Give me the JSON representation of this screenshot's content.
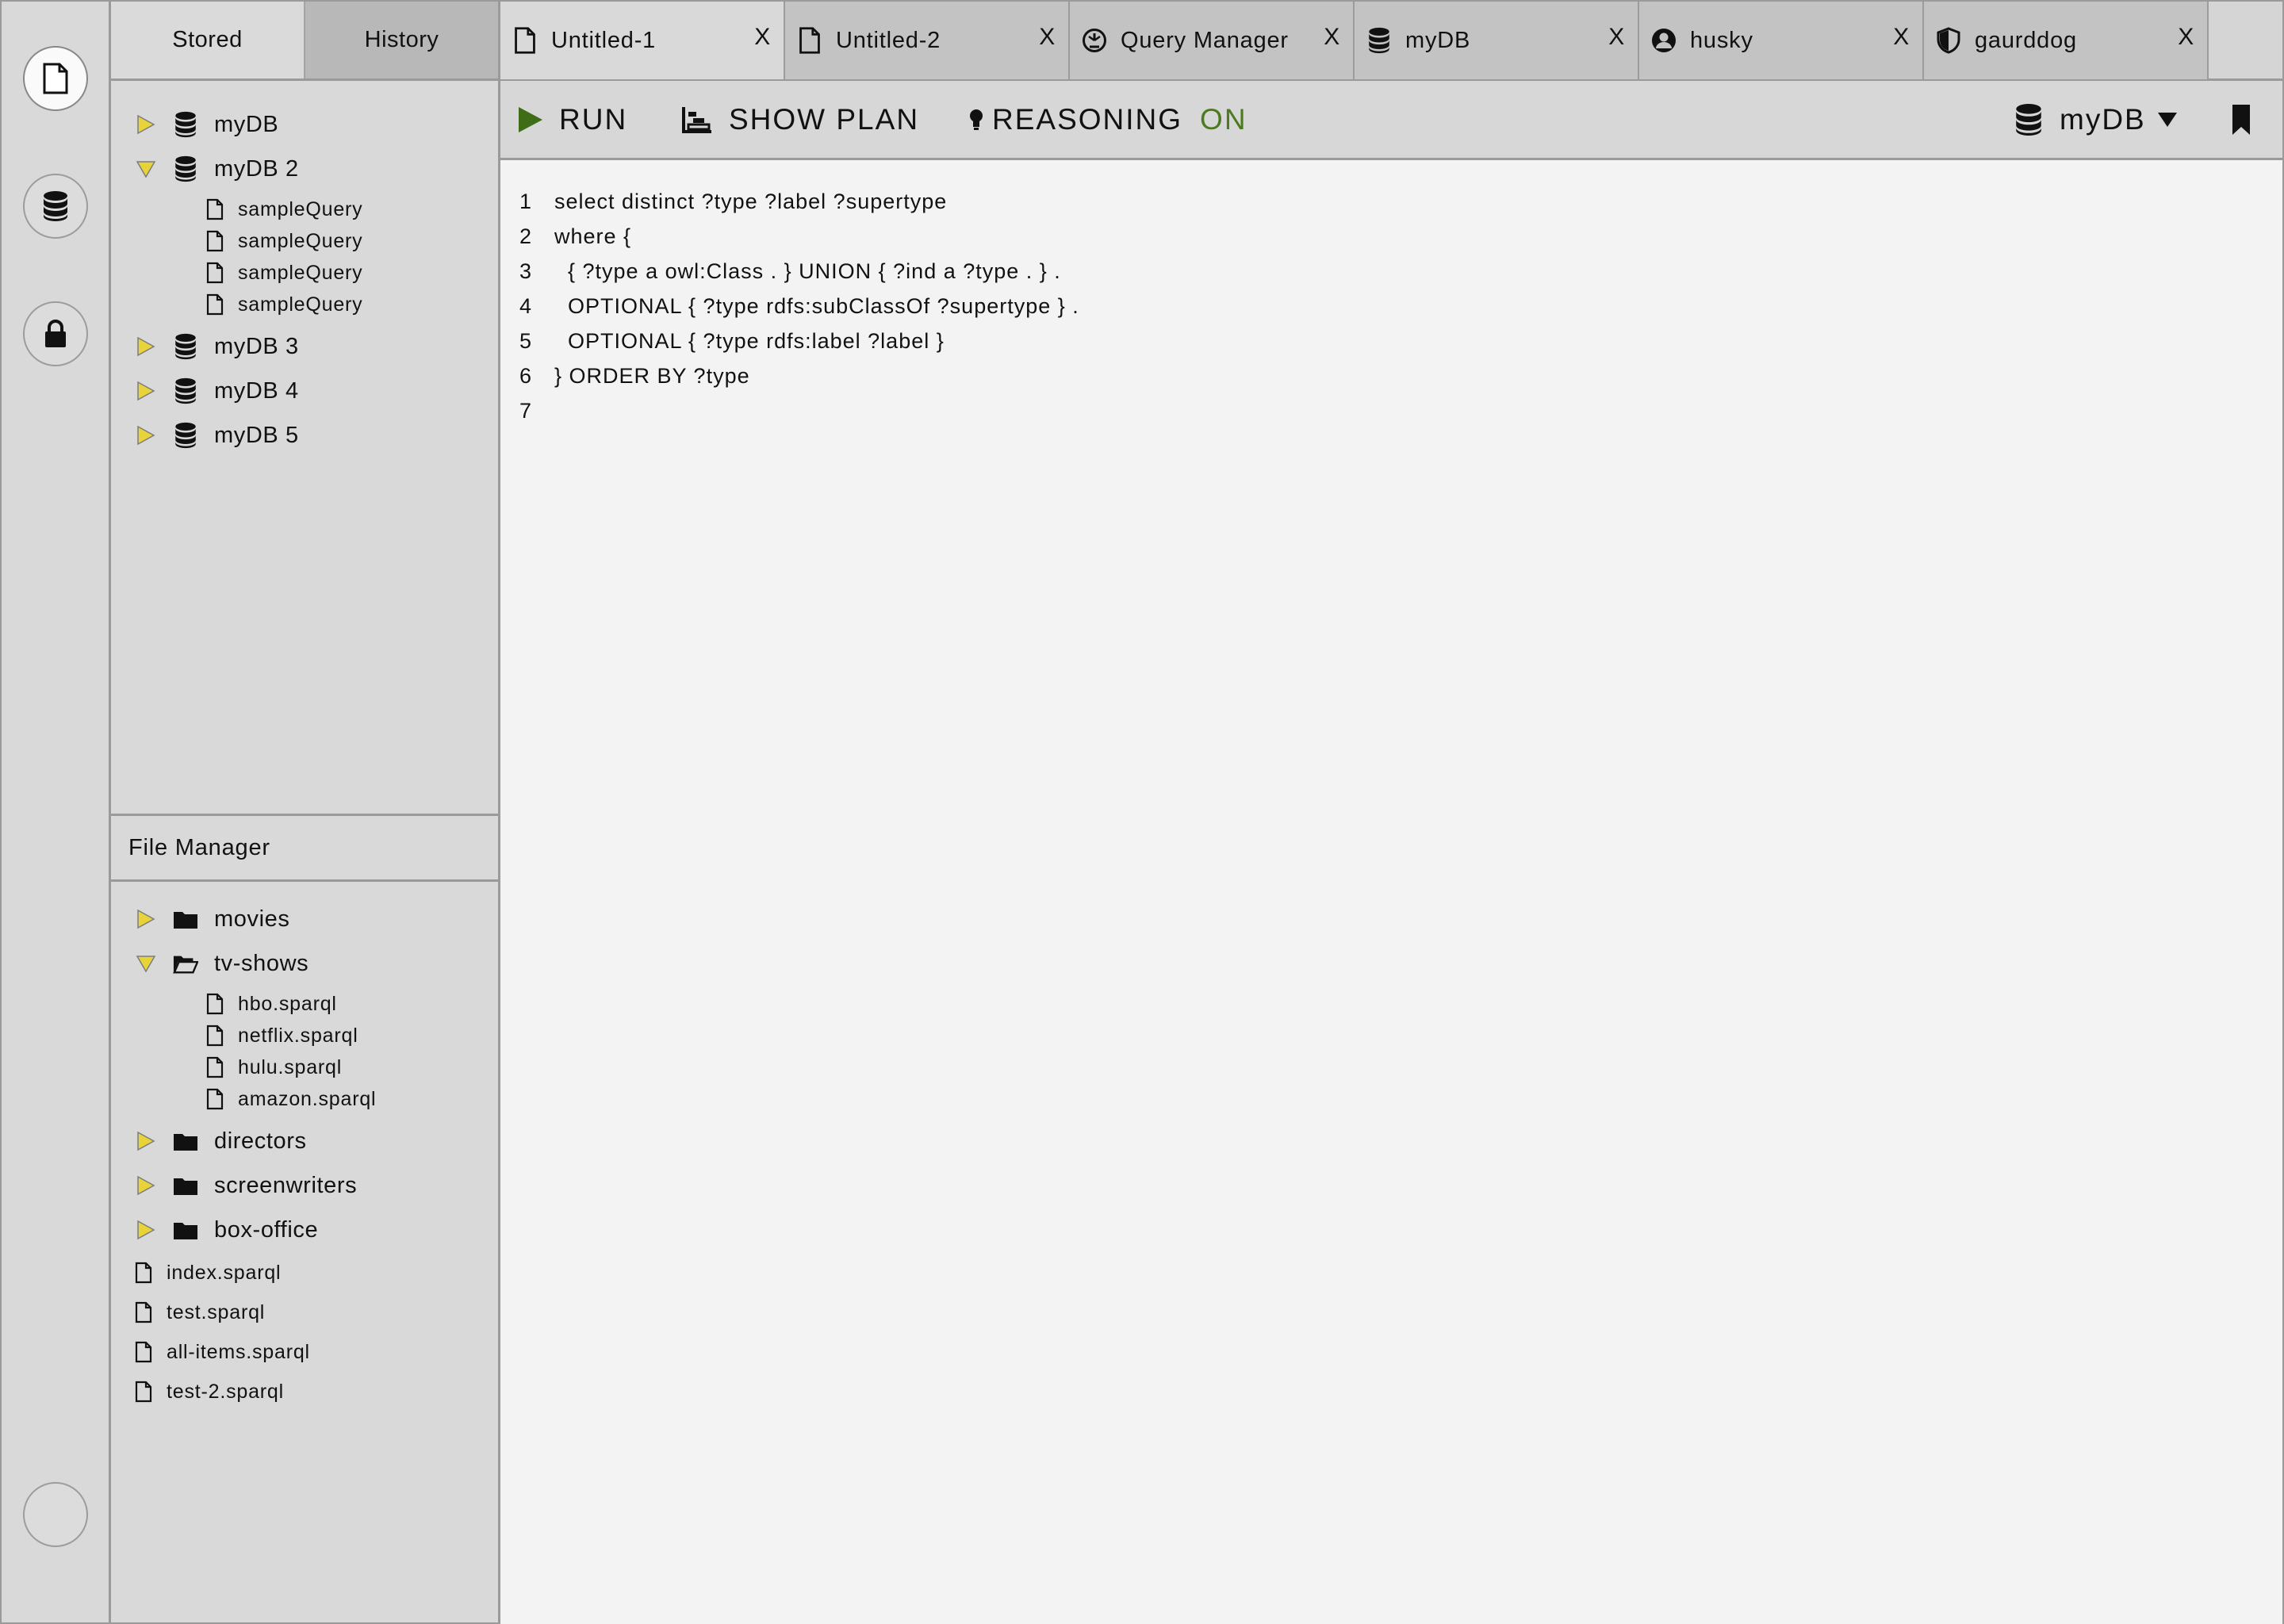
{
  "rail": {
    "buttons": [
      {
        "name": "document",
        "active": true
      },
      {
        "name": "database",
        "active": false
      },
      {
        "name": "lock",
        "active": false
      },
      {
        "name": "empty",
        "active": false
      }
    ]
  },
  "sidebar": {
    "tabs": [
      "Stored",
      "History"
    ],
    "stored_tree": [
      {
        "label": "myDB",
        "expanded": false,
        "children": []
      },
      {
        "label": "myDB 2",
        "expanded": true,
        "children": [
          "sampleQuery",
          "sampleQuery",
          "sampleQuery",
          "sampleQuery"
        ]
      },
      {
        "label": "myDB 3",
        "expanded": false,
        "children": []
      },
      {
        "label": "myDB 4",
        "expanded": false,
        "children": []
      },
      {
        "label": "myDB 5",
        "expanded": false,
        "children": []
      }
    ],
    "file_manager": {
      "title": "File Manager",
      "folders": [
        {
          "label": "movies",
          "expanded": false,
          "children": []
        },
        {
          "label": "tv-shows",
          "expanded": true,
          "children": [
            "hbo.sparql",
            "netflix.sparql",
            "hulu.sparql",
            "amazon.sparql"
          ]
        },
        {
          "label": "directors",
          "expanded": false,
          "children": []
        },
        {
          "label": "screenwriters",
          "expanded": false,
          "children": []
        },
        {
          "label": "box-office",
          "expanded": false,
          "children": []
        }
      ],
      "files": [
        "index.sparql",
        "test.sparql",
        "all-items.sparql",
        "test-2.sparql"
      ]
    }
  },
  "tabs": [
    {
      "label": "Untitled-1",
      "icon": "document-icon",
      "close": "X",
      "active": true
    },
    {
      "label": "Untitled-2",
      "icon": "document-icon",
      "close": "X",
      "active": false
    },
    {
      "label": "Query Manager",
      "icon": "gauge-icon",
      "close": "X",
      "active": false
    },
    {
      "label": "myDB",
      "icon": "database-icon",
      "close": "X",
      "active": false
    },
    {
      "label": "husky",
      "icon": "user-icon",
      "close": "X",
      "active": false
    },
    {
      "label": "gaurddog",
      "icon": "shield-icon",
      "close": "X",
      "active": false
    }
  ],
  "toolbar": {
    "run_label": "RUN",
    "show_plan_label": "SHOW PLAN",
    "reasoning_label": "REASONING",
    "reasoning_state": "ON",
    "db_selector": "myDB",
    "colors": {
      "reasoning_on": "#4c7a1e",
      "run_icon": "#3f6d17",
      "tree_arrow": "#e8d43a"
    }
  },
  "editor": {
    "lines": [
      {
        "num": "1",
        "text": "select distinct ?type ?label ?supertype"
      },
      {
        "num": "2",
        "text": "where {"
      },
      {
        "num": "3",
        "text": "  { ?type a owl:Class . } UNION { ?ind a ?type . } ."
      },
      {
        "num": "4",
        "text": "  OPTIONAL { ?type rdfs:subClassOf ?supertype } ."
      },
      {
        "num": "5",
        "text": "  OPTIONAL { ?type rdfs:label ?label }"
      },
      {
        "num": "6",
        "text": "} ORDER BY ?type"
      },
      {
        "num": "7",
        "text": ""
      }
    ]
  }
}
